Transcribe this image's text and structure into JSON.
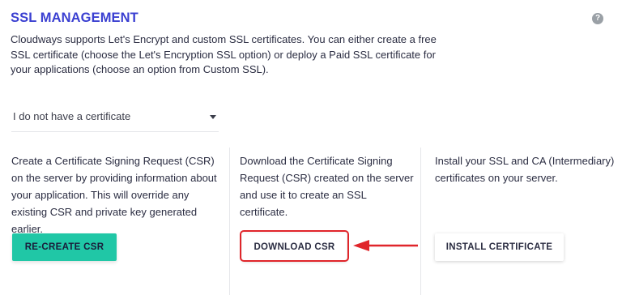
{
  "header": {
    "title": "SSL MANAGEMENT",
    "help_icon": "question-circle-icon",
    "help_glyph": "?"
  },
  "description": "Cloudways supports Let's Encrypt and custom SSL certificates. You can either create a free SSL certificate (choose the Let's Encryption SSL option) or deploy a Paid SSL certificate for your applications (choose an option from Custom SSL).",
  "certificate_select": {
    "value": "I do not have a certificate",
    "icon": "caret-down-icon"
  },
  "steps": [
    {
      "text": "Create a Certificate Signing Request (CSR) on the server by providing information about your application. This will override any existing CSR and private key generated earlier.",
      "button_label": "RE-CREATE CSR"
    },
    {
      "text": "Download the Certificate Signing Request (CSR) created on the server and use it to create an SSL certificate.",
      "button_label": "DOWNLOAD CSR"
    },
    {
      "text": "Install your SSL and CA (Intermediary) certificates on your server.",
      "button_label": "INSTALL CERTIFICATE"
    }
  ],
  "annotation": {
    "color": "#e0252a",
    "target": "DOWNLOAD CSR"
  },
  "colors": {
    "title": "#3a3fd1",
    "primary_button": "#20c7a6",
    "text": "#2b2d42",
    "help_icon": "#9aa0a6"
  }
}
